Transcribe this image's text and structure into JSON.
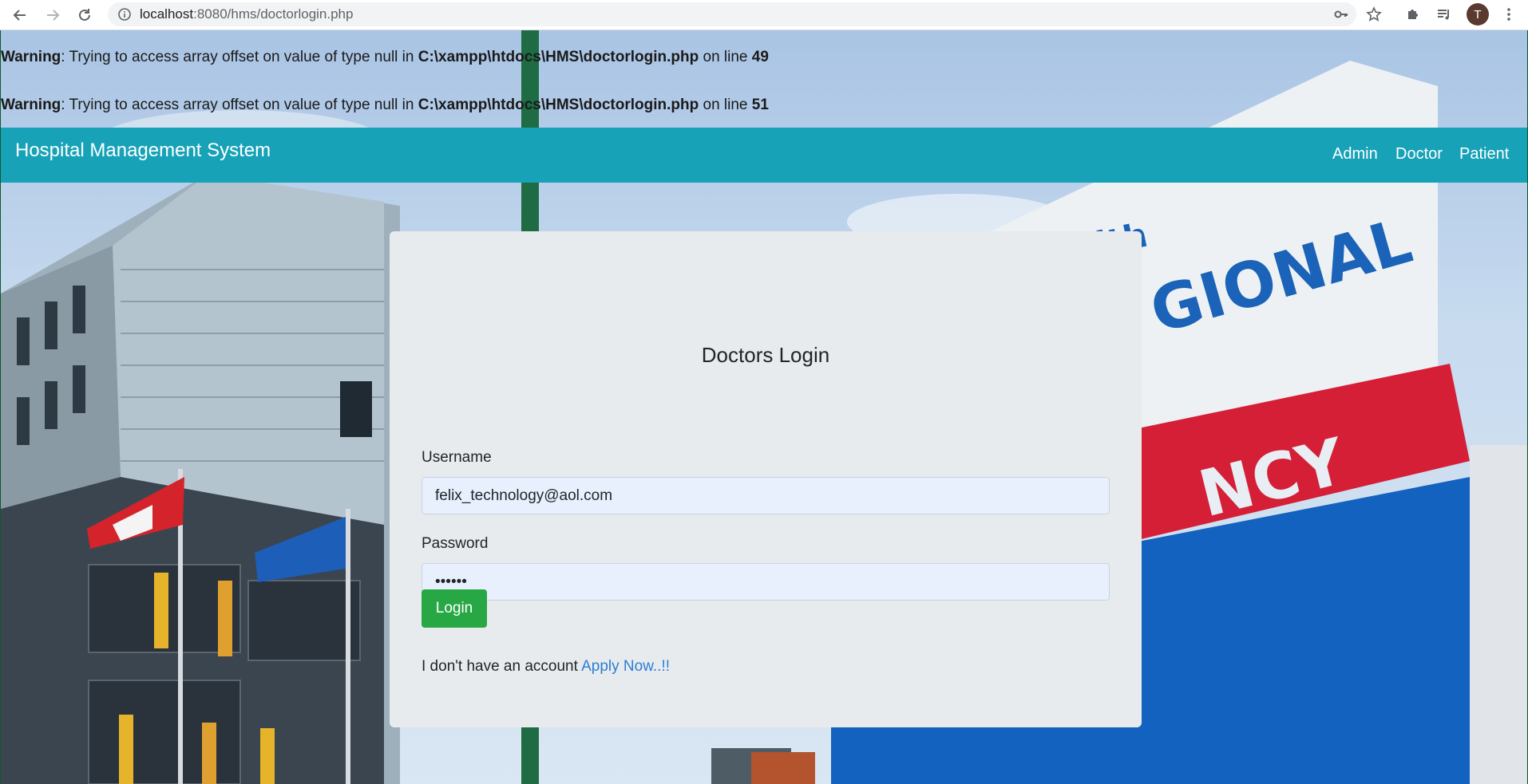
{
  "browser": {
    "url_host": "localhost",
    "url_path": ":8080/hms/doctorlogin.php",
    "profile_initial": "T"
  },
  "warnings": [
    {
      "label": "Warning",
      "message": ": Trying to access array offset on value of type null in ",
      "file": "C:\\xampp\\htdocs\\HMS\\doctorlogin.php",
      "on_line": " on line ",
      "line": "49"
    },
    {
      "label": "Warning",
      "message": ": Trying to access array offset on value of type null in ",
      "file": "C:\\xampp\\htdocs\\HMS\\doctorlogin.php",
      "on_line": " on line ",
      "line": "51"
    }
  ],
  "navbar": {
    "brand": "Hospital Management System",
    "links": [
      "Admin",
      "Doctor",
      "Patient"
    ],
    "color": "#17a2b8"
  },
  "login": {
    "title": "Doctors Login",
    "username_label": "Username",
    "username_value": "felix_technology@aol.com",
    "password_label": "Password",
    "password_value": "••••••",
    "button_label": "Login",
    "no_account_text": "I don't have an account ",
    "apply_link": "Apply Now..!!",
    "button_color": "#28a745",
    "link_color": "#2b7ed6"
  },
  "icons": {
    "back": "arrow-left-icon",
    "forward": "arrow-right-icon",
    "reload": "reload-icon",
    "site_info": "info-icon",
    "key": "key-icon",
    "bookmark": "star-icon",
    "extensions": "puzzle-icon",
    "media": "playlist-icon",
    "menu": "kebab-menu-icon"
  }
}
